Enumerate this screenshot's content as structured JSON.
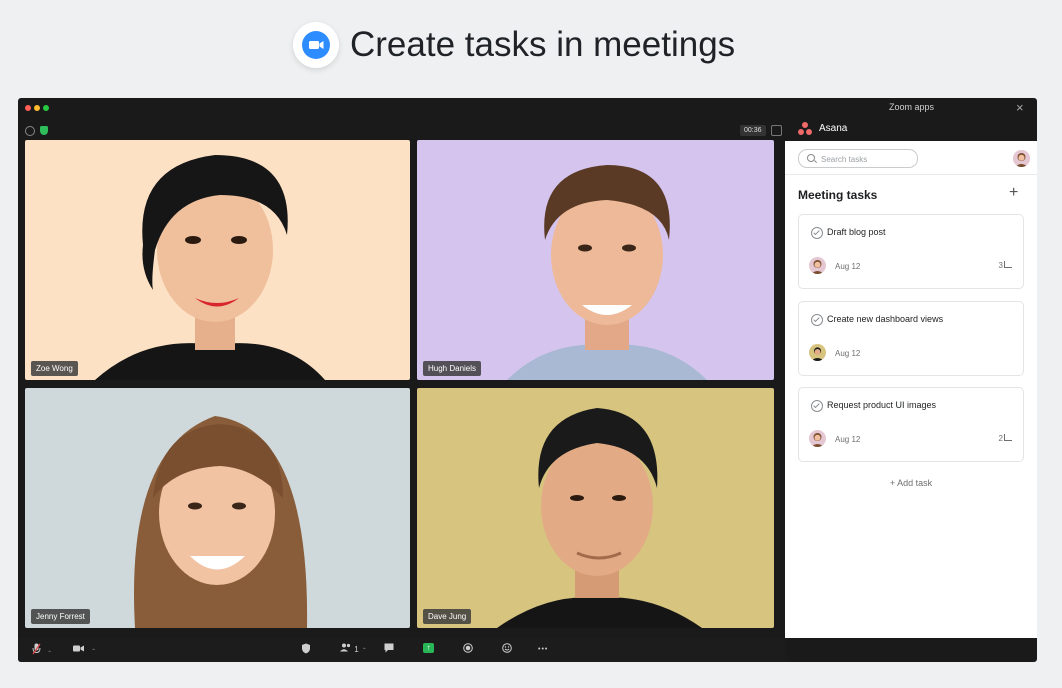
{
  "headline": {
    "app_icon": "zoom-video-camera-icon",
    "title": "Create tasks in meetings"
  },
  "zoom_window": {
    "panel_title": "Zoom apps",
    "close_glyph": "×",
    "timer": "00:36",
    "participants": [
      {
        "name": "Zoe Wong",
        "background": "#fde1c4"
      },
      {
        "name": "Hugh Daniels",
        "background": "#d5c5ee"
      },
      {
        "name": "Jenny Forrest",
        "background": "#cfd9dc"
      },
      {
        "name": "Dave Jung",
        "background": "#d6c47f"
      }
    ],
    "toolbar_icons": [
      "microphone-icon",
      "video-camera-icon",
      "security-icon",
      "participants-icon",
      "chat-icon",
      "share-screen-icon",
      "record-icon",
      "reactions-icon",
      "more-icon"
    ],
    "toolbar_glyphs": {
      "caret": "⌃",
      "participants_count": "1",
      "more": "•••",
      "share": "↑"
    }
  },
  "asana": {
    "app_name": "Asana",
    "brand_color": "#f06a6a",
    "search_placeholder": "Search tasks",
    "section_title": "Meeting tasks",
    "add_glyph": "+",
    "tasks": [
      {
        "title": "Draft blog post",
        "due": "Aug 12",
        "subtasks": "3"
      },
      {
        "title": "Create new dashboard views",
        "due": "Aug 12",
        "subtasks": ""
      },
      {
        "title": "Request product UI images",
        "due": "Aug 12",
        "subtasks": "2"
      }
    ],
    "add_task_label": "+ Add task"
  }
}
